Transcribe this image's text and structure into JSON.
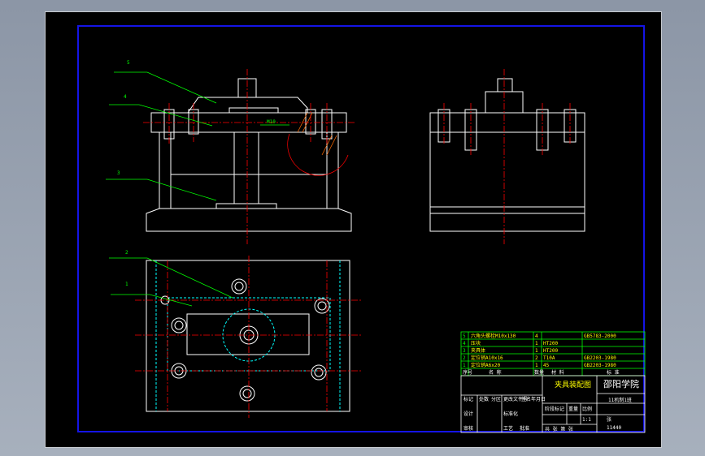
{
  "drawing": {
    "callouts": [
      "5",
      "4",
      "3",
      "2",
      "1"
    ],
    "dimension_text": "M10",
    "bom_rows": [
      {
        "no": "5",
        "name": "六角头螺栓M10x130",
        "qty": "4",
        "std": "GB5783-2000"
      },
      {
        "no": "4",
        "name": "压块",
        "qty": "1",
        "mat": "HT200"
      },
      {
        "no": "3",
        "name": "夹具体",
        "qty": "1",
        "mat": "HT200"
      },
      {
        "no": "2",
        "name": "定位销A10x16",
        "qty": "2",
        "mat": "T10A",
        "std": "GB2203-1980"
      },
      {
        "no": "1",
        "name": "定位销A6x20",
        "qty": "1",
        "mat": "45",
        "std": "GB2203-1980"
      }
    ],
    "bom_header": [
      "序号",
      "名 称",
      "数量",
      "材 料",
      "标 准"
    ],
    "title_block": {
      "drawing_name": "夹具装配图",
      "school": "邵阳学院",
      "class": "11机制1班",
      "scale_label": "比例",
      "scale_value": "1:1",
      "sheet_label": "张",
      "qty_label": "数量",
      "weight_label": "重量",
      "stage_label": "阶段标记",
      "drawing_no": "11440",
      "rows_left": [
        "标记",
        "处数",
        "分区",
        "更改文件号",
        "签名",
        "年月日"
      ],
      "roles": [
        "设计",
        "标准化",
        "审核",
        "工艺",
        "批准"
      ],
      "footer": "共 张 第 张"
    }
  },
  "colors": {
    "frame_blue": "#1414e6",
    "line_white": "#ffffff",
    "center_red": "#ff0000",
    "leader_green": "#00ff00",
    "hidden_cyan": "#00ffff",
    "text_yellow": "#ffff00"
  }
}
